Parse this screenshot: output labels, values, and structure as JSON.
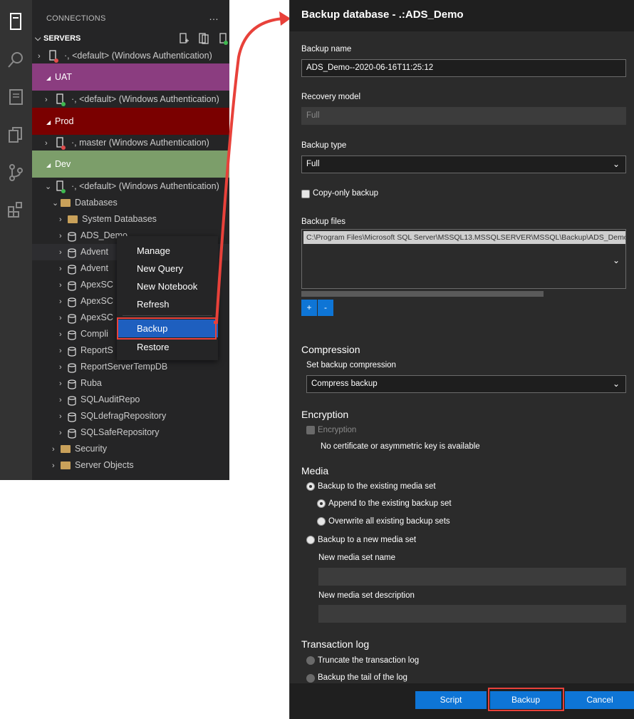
{
  "sidebar": {
    "header": "CONNECTIONS",
    "more": "…",
    "servers_label": "SERVERS",
    "items": [
      {
        "text": "<default> (Windows Authentication)",
        "prefix": "·,"
      },
      {
        "group": "UAT"
      },
      {
        "text": "<default> (Windows Authentication)",
        "prefix": "·,"
      },
      {
        "group": "Prod"
      },
      {
        "text": "master (Windows Authentication)",
        "prefix": "·,"
      },
      {
        "group": "Dev"
      },
      {
        "text": "<default> (Windows Authentication)",
        "prefix": "·,"
      }
    ],
    "databases_label": "Databases",
    "system_databases": "System Databases",
    "dbs": [
      "ADS_Demo",
      "Advent",
      "Advent",
      "ApexSC",
      "ApexSC",
      "ApexSC",
      "Compli",
      "ReportS",
      "ReportServerTempDB",
      "Ruba",
      "SQLAuditRepo",
      "SQLdefragRepository",
      "SQLSafeRepository"
    ],
    "security_label": "Security",
    "server_objects_label": "Server Objects"
  },
  "context_menu": {
    "items": [
      "Manage",
      "New Query",
      "New Notebook",
      "Refresh",
      "Backup",
      "Restore"
    ]
  },
  "dialog": {
    "title": "Backup database - .:ADS_Demo",
    "backup_name_label": "Backup name",
    "backup_name_value": "ADS_Demo--2020-06-16T11:25:12",
    "recovery_model_label": "Recovery model",
    "recovery_model_value": "Full",
    "backup_type_label": "Backup type",
    "backup_type_value": "Full",
    "copy_only_label": "Copy-only backup",
    "backup_files_label": "Backup files",
    "backup_file_path": "C:\\Program Files\\Microsoft SQL Server\\MSSQL13.MSSQLSERVER\\MSSQL\\Backup\\ADS_Demo",
    "add_btn": "+",
    "remove_btn": "-",
    "compression_header": "Compression",
    "set_compression_label": "Set backup compression",
    "compression_value": "Compress backup",
    "encryption_header": "Encryption",
    "encryption_label": "Encryption",
    "no_cert_text": "No certificate or asymmetric key is available",
    "media_header": "Media",
    "media_existing": "Backup to the existing media set",
    "append_set": "Append to the existing backup set",
    "overwrite_sets": "Overwrite all existing backup sets",
    "media_new": "Backup to a new media set",
    "new_media_name_label": "New media set name",
    "new_media_desc_label": "New media set description",
    "txlog_header": "Transaction log",
    "truncate_log": "Truncate the transaction log",
    "backup_tail": "Backup the tail of the log",
    "script_btn": "Script",
    "backup_btn": "Backup",
    "cancel_btn": "Cancel"
  },
  "colors": {
    "uat": "#8b3d80",
    "prod": "#7a0000",
    "dev": "#7c9e6a",
    "accent": "#0e75d6",
    "highlight": "#e8413a"
  }
}
